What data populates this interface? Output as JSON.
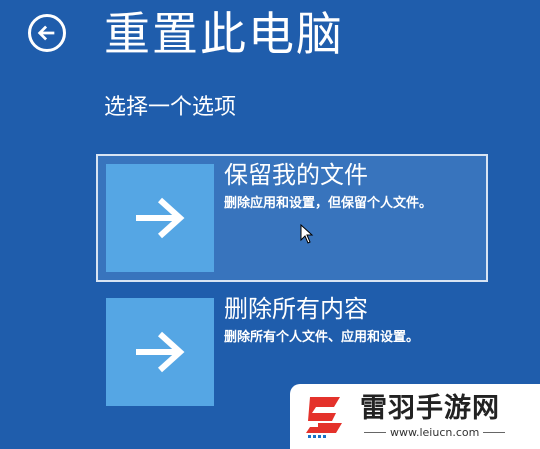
{
  "header": {
    "title": "重置此电脑",
    "back_icon": "back-arrow-icon"
  },
  "subtitle": "选择一个选项",
  "options": [
    {
      "title": "保留我的文件",
      "description": "删除应用和设置，但保留个人文件。",
      "icon": "right-arrow-icon",
      "selected": true
    },
    {
      "title": "删除所有内容",
      "description": "删除所有个人文件、应用和设置。",
      "icon": "right-arrow-icon",
      "selected": false
    }
  ],
  "watermark": {
    "name": "雷羽手游网",
    "url": "www.leiucn.com",
    "logo_icon": "leiyu-logo-icon"
  },
  "colors": {
    "background": "#1f5dac",
    "selected_option": "#3874bd",
    "tile": "#55a6e4",
    "text": "#ffffff"
  }
}
